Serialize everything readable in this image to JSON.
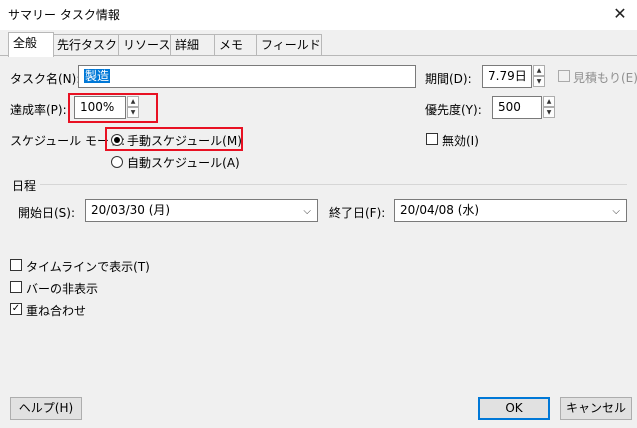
{
  "window": {
    "title": "サマリー タスク情報",
    "close": "✕"
  },
  "tabs": [
    {
      "label": "全般"
    },
    {
      "label": "先行タスク"
    },
    {
      "label": "リソース"
    },
    {
      "label": "詳細"
    },
    {
      "label": "メモ"
    },
    {
      "label": "フィールド"
    }
  ],
  "form": {
    "task_name_label": "タスク名(N):",
    "task_name_value": "製造",
    "duration_label": "期間(D):",
    "duration_value": "7.79日",
    "estimate_label": "見積もり(E)",
    "progress_label": "達成率(P):",
    "progress_value": "100%",
    "priority_label": "優先度(Y):",
    "priority_value": "500",
    "schedule_mode_label": "スケジュール モード:",
    "manual_label": "手動スケジュール(M)",
    "auto_label": "自動スケジュール(A)",
    "inactive_label": "無効(I)"
  },
  "dates": {
    "section_label": "日程",
    "start_label": "開始日(S):",
    "start_value": "20/03/30 (月)",
    "finish_label": "終了日(F):",
    "finish_value": "20/04/08 (水)"
  },
  "options": {
    "timeline_label": "タイムラインで表示(T)",
    "hide_bar_label": "バーの非表示",
    "rollup_label": "重ね合わせ",
    "rollup_checked": "✓"
  },
  "buttons": {
    "help": "ヘルプ(H)",
    "ok": "OK",
    "cancel": "キャンセル"
  },
  "icons": {
    "spin_up": "▲",
    "spin_down": "▼",
    "dropdown": "⌵"
  },
  "colors": {
    "highlight": "#e81123",
    "selection": "#0078d7"
  }
}
